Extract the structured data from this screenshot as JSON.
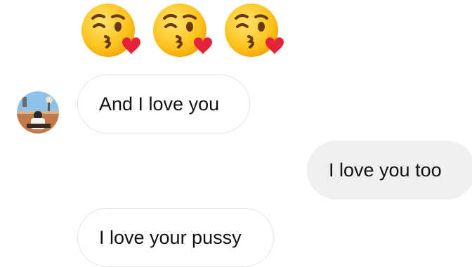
{
  "emojis": [
    {
      "icon": "face-blowing-kiss-icon"
    },
    {
      "icon": "face-blowing-kiss-icon"
    },
    {
      "icon": "face-blowing-kiss-icon"
    }
  ],
  "messages": [
    {
      "direction": "incoming",
      "text": "And I love you"
    },
    {
      "direction": "outgoing",
      "text": "I love you too"
    },
    {
      "direction": "incoming",
      "text": "I love your pussy"
    }
  ],
  "colors": {
    "incoming_bubble_bg": "#ffffff",
    "incoming_bubble_border": "#e4e4e4",
    "outgoing_bubble_bg": "#efefef",
    "text": "#111111",
    "emoji_face": "#fcc21b",
    "heart": "#e5223a"
  },
  "avatar": {
    "icon": "contact-avatar"
  }
}
